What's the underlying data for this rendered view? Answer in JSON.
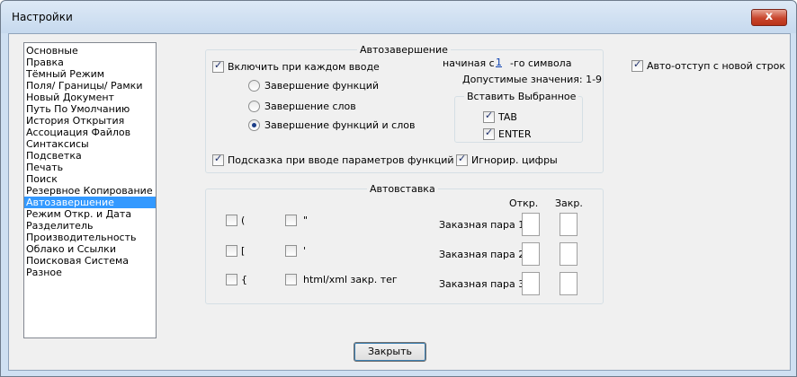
{
  "window": {
    "title": "Настройки",
    "close_glyph": "x"
  },
  "sidebar": {
    "items": [
      {
        "label": "Основные"
      },
      {
        "label": "Правка"
      },
      {
        "label": "Тёмный Режим"
      },
      {
        "label": "Поля/ Границы/ Рамки"
      },
      {
        "label": "Новый Документ"
      },
      {
        "label": "Путь По Умолчанию"
      },
      {
        "label": "История Открытия"
      },
      {
        "label": "Ассоциация Файлов"
      },
      {
        "label": "Синтаксисы"
      },
      {
        "label": "Подсветка"
      },
      {
        "label": "Печать"
      },
      {
        "label": "Поиск"
      },
      {
        "label": "Резервное Копирование"
      },
      {
        "label": "Автозавершение",
        "selected": true
      },
      {
        "label": "Режим Откр. и Дата"
      },
      {
        "label": "Разделитель"
      },
      {
        "label": "Производительность"
      },
      {
        "label": "Облако и Ссылки"
      },
      {
        "label": "Поисковая Система"
      },
      {
        "label": "Разное"
      }
    ]
  },
  "autocomplete": {
    "title": "Автозавершение",
    "enable_label": "Включить при каждом вводе",
    "start_prefix": "начиная с",
    "start_value": "1",
    "start_suffix": "-го символа",
    "allowed_values": "Допустимые значения: 1-9",
    "radio_functions": "Завершение функций",
    "radio_words": "Завершение слов",
    "radio_both": "Завершение функций и слов",
    "insert_group_title": "Вставить Выбранное",
    "tab_label": "TAB",
    "enter_label": "ENTER",
    "hint_label": "Подсказка при вводе параметров функций",
    "ignore_digits_label": "Игнорир. цифры"
  },
  "auto_indent_label": "Авто-отступ с новой строк",
  "autoinsert": {
    "title": "Автовставка",
    "paren": "(",
    "bracket": "[",
    "brace": "{",
    "dquote": "\"",
    "squote": "'",
    "html_tag": "html/xml закр. тег",
    "open_header": "Откр.",
    "close_header": "Закр.",
    "pair1": "Заказная пара 1:",
    "pair2": "Заказная пара 2:",
    "pair3": "Заказная пара 3:"
  },
  "footer": {
    "close_button": "Закрыть"
  }
}
